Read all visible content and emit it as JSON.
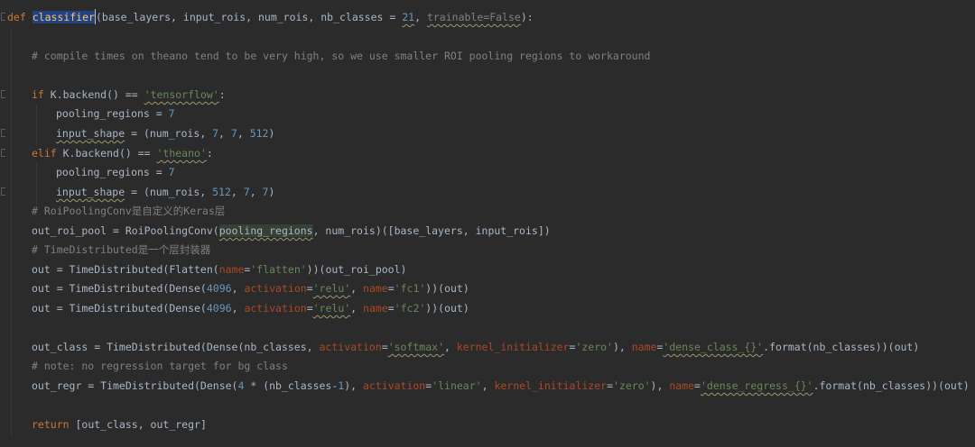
{
  "code": {
    "l1": {
      "def": "def",
      "fname": "classifier",
      "params_a": "(base_layers, input_rois, num_rois, nb_classes = ",
      "num_default": "21",
      "comma": ", ",
      "trainable": "trainable",
      "eq_false": "=False",
      "close": "):"
    },
    "l3": "# compile times on theano tend to be very high, so we use smaller ROI pooling regions to workaround",
    "l5": {
      "kw": "if",
      "a": " K.backend() == ",
      "str": "'tensorflow'",
      "b": ":"
    },
    "l6": {
      "a": "pooling_regions = ",
      "n": "7"
    },
    "l7": {
      "a": "input_shape",
      "b": " = (num_rois, ",
      "n1": "7",
      "c1": ", ",
      "n2": "7",
      "c2": ", ",
      "n3": "512",
      "d": ")"
    },
    "l8": {
      "kw": "elif",
      "a": " K.backend() == ",
      "str": "'theano'",
      "b": ":"
    },
    "l9": {
      "a": "pooling_regions = ",
      "n": "7"
    },
    "l10": {
      "a": "input_shape",
      "b": " = (num_rois, ",
      "n1": "512",
      "c1": ", ",
      "n2": "7",
      "c2": ", ",
      "n3": "7",
      "d": ")"
    },
    "l11": "# RoiPoolingConv是自定义的Keras层",
    "l12": {
      "a": "out_roi_pool = RoiPoolingConv(",
      "hl": "pooling_regions",
      "b": ", num_rois)([base_layers, input_rois])"
    },
    "l13": "# TimeDistributed是一个层封装器",
    "l14": {
      "a": "out = TimeDistributed(Flatten(",
      "p": "name",
      "eq": "=",
      "s": "'flatten'",
      "b": "))(out_roi_pool)"
    },
    "l15": {
      "a": "out = TimeDistributed(Dense(",
      "n": "4096",
      "c": ", ",
      "p1": "activation",
      "eq1": "=",
      "s1": "'relu'",
      "c2": ", ",
      "p2": "name",
      "eq2": "=",
      "s2": "'fc1'",
      "b": "))(out)"
    },
    "l16": {
      "a": "out = TimeDistributed(Dense(",
      "n": "4096",
      "c": ", ",
      "p1": "activation",
      "eq1": "=",
      "s1": "'relu'",
      "c2": ", ",
      "p2": "name",
      "eq2": "=",
      "s2": "'fc2'",
      "b": "))(out)"
    },
    "l18": {
      "a": "out_class = TimeDistributed(Dense(nb_classes, ",
      "p1": "activation",
      "eq1": "=",
      "s1": "'softmax'",
      "c1": ", ",
      "p2": "kernel_initializer",
      "eq2": "=",
      "s2": "'zero'",
      "c2": "), ",
      "p3": "name",
      "eq3": "=",
      "s3": "'dense_class_{}'",
      "b": ".format(nb_classes))(out)"
    },
    "l19": "# note: no regression target for bg class",
    "l20": {
      "a": "out_regr = TimeDistributed(Dense(",
      "n": "4",
      "op": " * (nb_classes-",
      "n2": "1",
      "c0": "), ",
      "p1": "activation",
      "eq1": "=",
      "s1": "'linear'",
      "c1": ", ",
      "p2": "kernel_initializer",
      "eq2": "=",
      "s2": "'zero'",
      "c2": "), ",
      "p3": "name",
      "eq3": "=",
      "s3": "'dense_regress_{}'",
      "b": ".format(nb_classes))(out)"
    },
    "l22": {
      "kw": "return",
      "a": " [out_class, out_regr]"
    }
  },
  "colors": {
    "background": "#2b2b2b",
    "keyword": "#cc7832",
    "comment": "#808080",
    "string": "#6a8759",
    "number": "#6897bb",
    "param": "#aa4926",
    "selection": "#214283"
  }
}
